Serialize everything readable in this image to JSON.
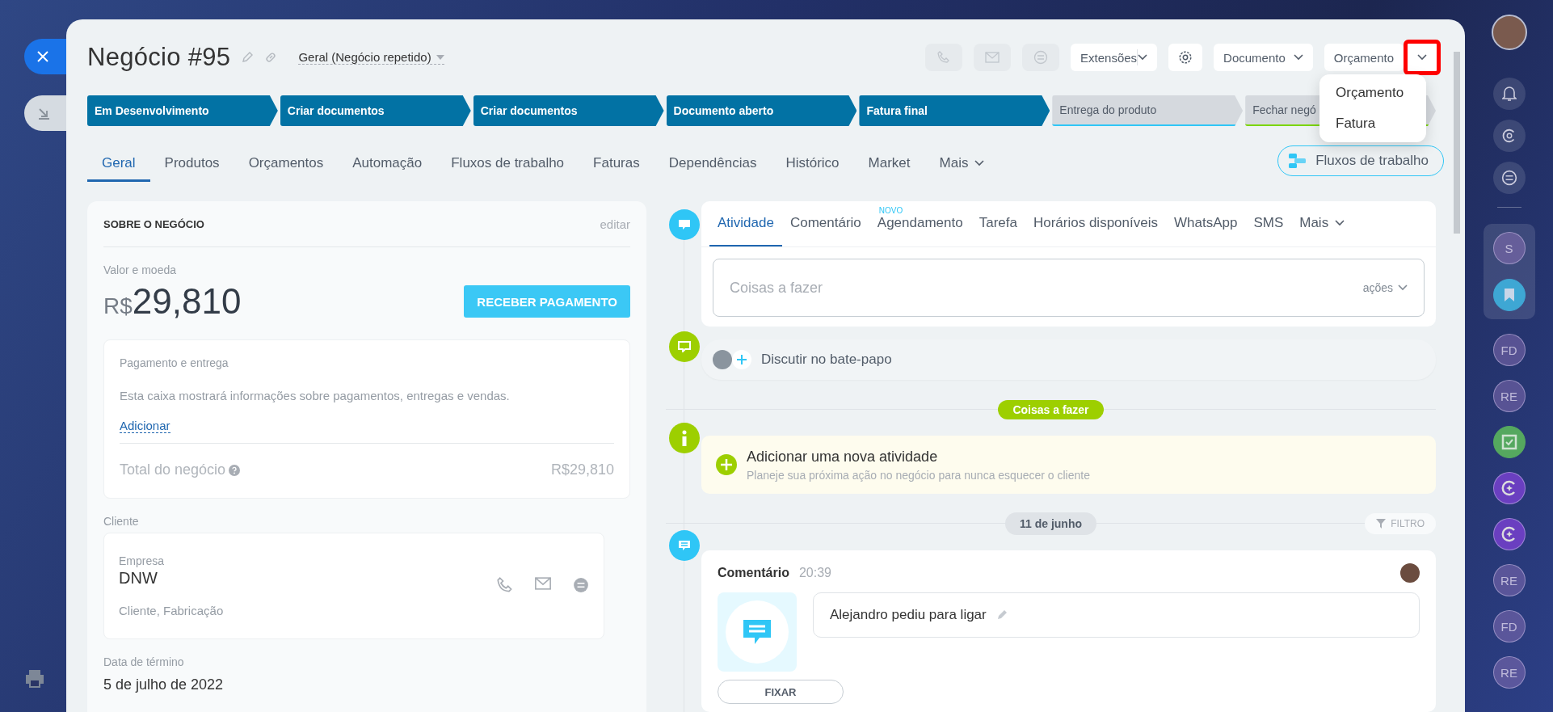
{
  "header": {
    "title": "Negócio #95",
    "pipeline": "Geral (Negócio repetido)",
    "buttons": [
      {
        "kind": "split",
        "label": "Extensões"
      },
      {
        "kind": "settings"
      },
      {
        "kind": "dropdown",
        "label": "Documento"
      },
      {
        "kind": "split-highlighted",
        "label": "Orçamento"
      }
    ]
  },
  "dropdown_menu": {
    "items": [
      "Orçamento",
      "Fatura"
    ]
  },
  "stages": [
    {
      "label": "Em Desenvolvimento",
      "passed": true,
      "color": "#0272a4"
    },
    {
      "label": "Criar documentos",
      "passed": true,
      "color": "#0272a4"
    },
    {
      "label": "Criar documentos",
      "passed": true,
      "color": "#0272a4"
    },
    {
      "label": "Documento aberto",
      "passed": true,
      "color": "#0272a4"
    },
    {
      "label": "Fatura final",
      "passed": true,
      "color": "#0272a4"
    },
    {
      "label": "Entrega do produto",
      "passed": false,
      "color": "#2fc6f6"
    },
    {
      "label": "Fechar negó",
      "passed": false,
      "color": "#7bd500"
    }
  ],
  "tabs": [
    {
      "label": "Geral",
      "selected": true
    },
    {
      "label": "Produtos",
      "selected": false
    },
    {
      "label": "Orçamentos",
      "selected": false
    },
    {
      "label": "Automação",
      "selected": false
    },
    {
      "label": "Fluxos de trabalho",
      "selected": false
    },
    {
      "label": "Faturas",
      "selected": false
    },
    {
      "label": "Dependências",
      "selected": false
    },
    {
      "label": "Histórico",
      "selected": false
    },
    {
      "label": "Market",
      "selected": false
    },
    {
      "label": "Mais",
      "selected": false
    }
  ],
  "workflows_button": "Fluxos de trabalho",
  "about": {
    "heading": "SOBRE O NEGÓCIO",
    "edit": "editar",
    "amount_label": "Valor e moeda",
    "currency": "R$",
    "amount": "29,810",
    "pay_button": "RECEBER PAGAMENTO",
    "payment": {
      "title": "Pagamento e entrega",
      "text": "Esta caixa mostrará informações sobre pagamentos, entregas e vendas.",
      "link": "Adicionar",
      "total_label": "Total do negócio",
      "total": "R$29,810"
    },
    "client_label": "Cliente",
    "client": {
      "type": "Empresa",
      "name": "DNW",
      "tags": "Cliente, Fabricação"
    },
    "end_label": "Data de término",
    "end_date": "5 de julho de 2022"
  },
  "activity": {
    "tabs": [
      {
        "label": "Atividade",
        "selected": true
      },
      {
        "label": "Comentário",
        "selected": false
      },
      {
        "label": "Agendamento",
        "selected": false,
        "badge": "NOVO"
      },
      {
        "label": "Tarefa",
        "selected": false
      },
      {
        "label": "Horários disponíveis",
        "selected": false
      },
      {
        "label": "WhatsApp",
        "selected": false
      },
      {
        "label": "SMS",
        "selected": false
      },
      {
        "label": "Mais",
        "selected": false
      }
    ],
    "placeholder": "Coisas a fazer",
    "actions": "ações"
  },
  "chat": "Discutir no bate-papo",
  "todo_divider": "Coisas a fazer",
  "add_activity": {
    "title": "Adicionar uma nova atividade",
    "text": "Planeje sua próxima ação no negócio para nunca esquecer o cliente"
  },
  "date_divider": "11 de junho",
  "filter": "FILTRO",
  "comment": {
    "title": "Comentário",
    "time": "20:39",
    "text": "Alejandro pediu para ligar",
    "pin": "FIXAR"
  },
  "right_sidebar": {
    "items": [
      {
        "kind": "letters",
        "label": "S"
      },
      {
        "kind": "bookmark"
      },
      {
        "kind": "letters",
        "label": "FD"
      },
      {
        "kind": "letters",
        "label": "RE"
      },
      {
        "kind": "task"
      },
      {
        "kind": "copilot"
      },
      {
        "kind": "copilot"
      },
      {
        "kind": "letters",
        "label": "RE"
      },
      {
        "kind": "letters",
        "label": "FD"
      },
      {
        "kind": "letters",
        "label": "RE"
      }
    ]
  }
}
